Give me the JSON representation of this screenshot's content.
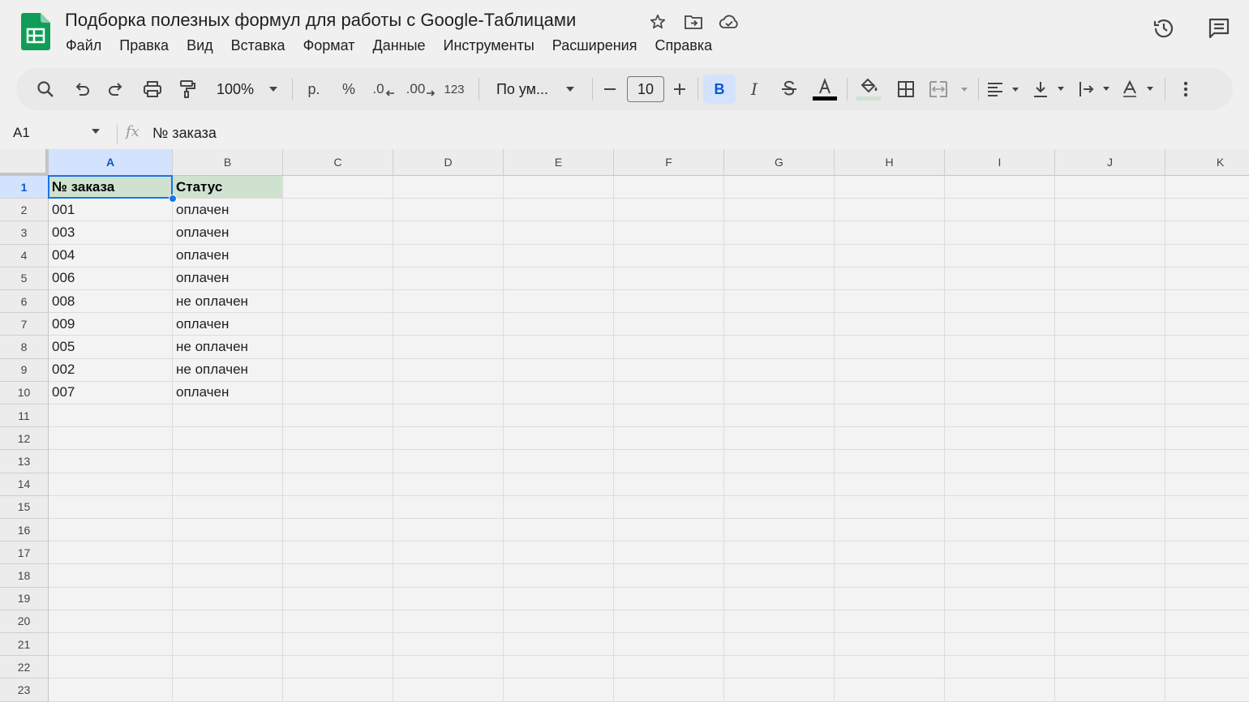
{
  "document": {
    "title": "Подборка полезных формул для работы с Google-Таблицами"
  },
  "menu": [
    "Файл",
    "Правка",
    "Вид",
    "Вставка",
    "Формат",
    "Данные",
    "Инструменты",
    "Расширения",
    "Справка"
  ],
  "toolbar": {
    "zoom": "100%",
    "currency": "р.",
    "percent": "%",
    "decrease_decimal": ".0",
    "increase_decimal": ".00",
    "number_format": "123",
    "font": "По ум...",
    "font_size": "10",
    "bold": "B",
    "italic": "I"
  },
  "formula_bar": {
    "cell_ref": "A1",
    "fx": "fx",
    "value": "№ заказа"
  },
  "grid": {
    "columns": [
      "A",
      "B",
      "C",
      "D",
      "E",
      "F",
      "G",
      "H",
      "I",
      "J",
      "K"
    ],
    "rows": [
      "1",
      "2",
      "3",
      "4",
      "5",
      "6",
      "7",
      "8",
      "9",
      "10",
      "11",
      "12",
      "13",
      "14",
      "15",
      "16",
      "17",
      "18",
      "19",
      "20",
      "21",
      "22",
      "23"
    ],
    "cells": [
      [
        "№ заказа",
        "Статус"
      ],
      [
        "001",
        "оплачен"
      ],
      [
        "003",
        "оплачен"
      ],
      [
        "004",
        "оплачен"
      ],
      [
        "006",
        "оплачен"
      ],
      [
        "008",
        "не оплачен"
      ],
      [
        "009",
        "оплачен"
      ],
      [
        "005",
        "не оплачен"
      ],
      [
        "002",
        "не оплачен"
      ],
      [
        "007",
        "оплачен"
      ]
    ],
    "selected_cell": "A1",
    "header_fill": "#cfe2cf",
    "selection_color": "#1a73e8"
  },
  "icons": {
    "logo": "google-sheets-logo",
    "title": [
      "star-icon",
      "move-folder-icon",
      "cloud-status-icon"
    ],
    "header_right": [
      "version-history-icon",
      "comments-icon"
    ]
  }
}
